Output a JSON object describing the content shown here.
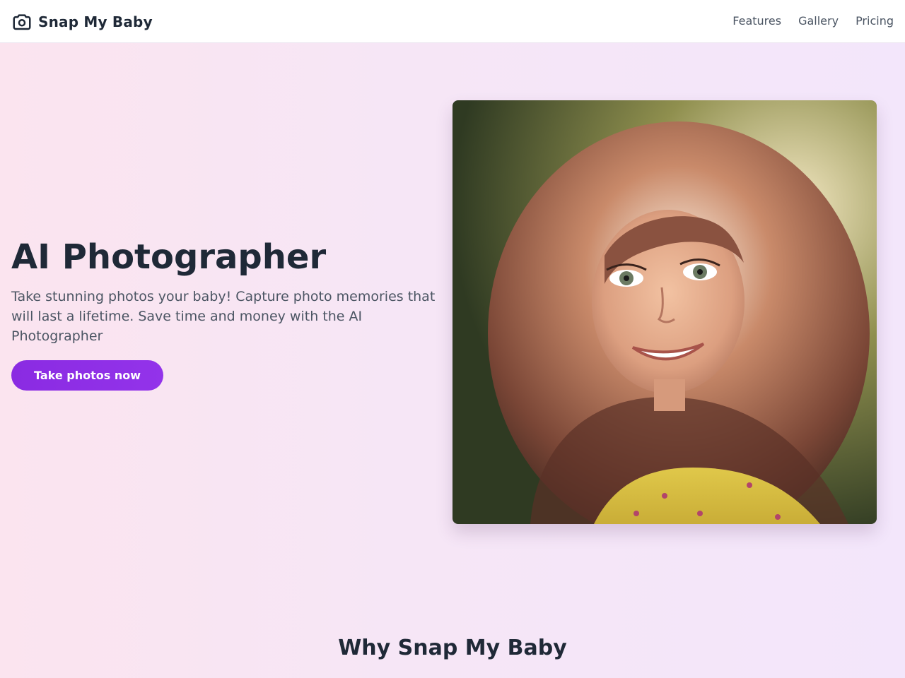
{
  "header": {
    "brand_icon": "camera-icon",
    "brand_name": "Snap My Baby",
    "nav": [
      {
        "label": "Features"
      },
      {
        "label": "Gallery"
      },
      {
        "label": "Pricing"
      }
    ]
  },
  "hero": {
    "title": "AI Photographer",
    "subtitle": "Take stunning photos your baby! Capture photo memories that will last a lifetime. Save time and money with the AI Photographer",
    "cta_label": "Take photos now",
    "image_alt": "Smiling young girl with long wavy hair in a yellow floral top"
  },
  "why_section": {
    "title": "Why Snap My Baby"
  },
  "colors": {
    "accent": "#9333ea",
    "text_dark": "#1f2937",
    "text_muted": "#4b5563",
    "background_left": "#fbe4ef",
    "background_right": "#f3e6fb"
  }
}
